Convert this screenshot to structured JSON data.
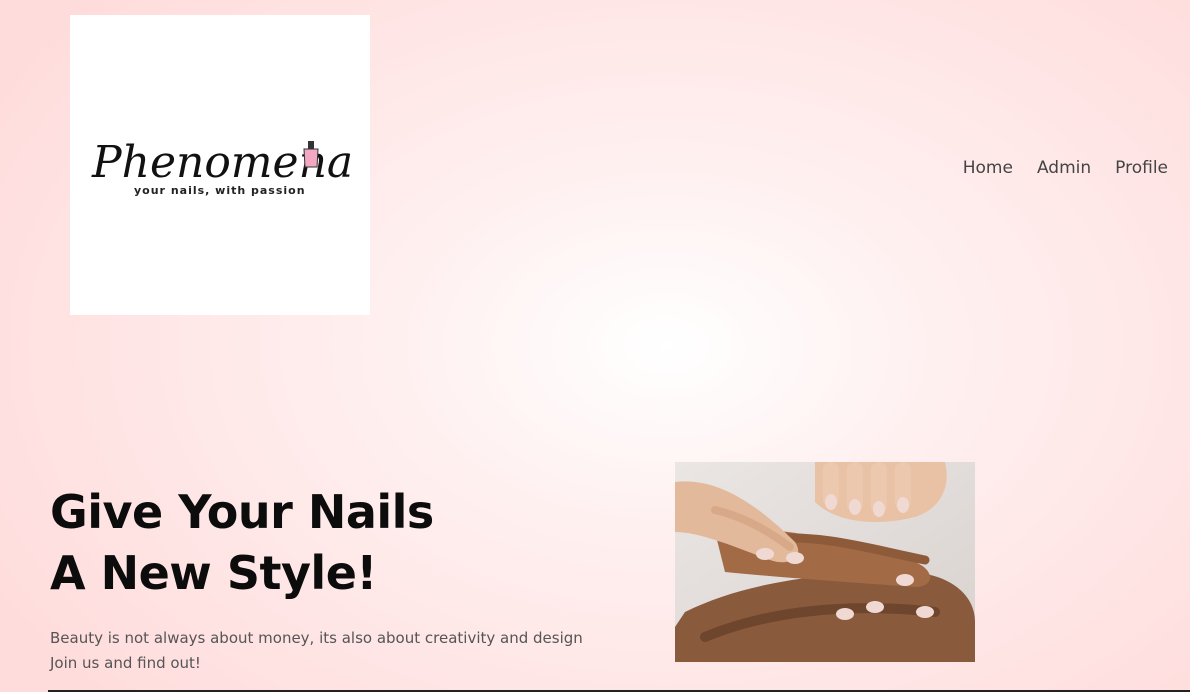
{
  "brand": {
    "name": "Phenomenail",
    "tagline": "your nails, with passion",
    "accent_color": "#f2a7c3"
  },
  "nav": {
    "items": [
      {
        "label": "Home"
      },
      {
        "label": "Admin"
      },
      {
        "label": "Profile"
      }
    ]
  },
  "hero": {
    "title_line1": "Give Your Nails",
    "title_line2": "A New Style!",
    "subtitle_line1": "Beauty is not always about money, its also about creativity and design",
    "subtitle_line2": "Join us and find out!",
    "image_icon": "stacked-hands-manicure-photo"
  }
}
